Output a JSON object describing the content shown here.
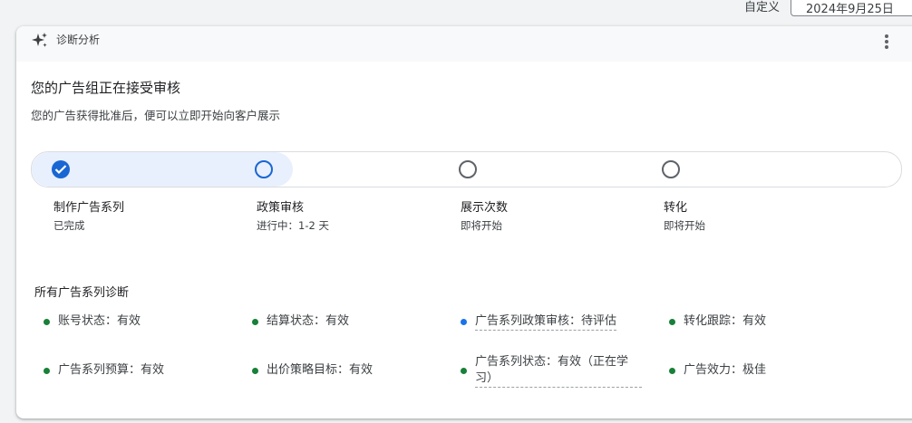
{
  "topbar": {
    "custom_label": "自定义",
    "date_value": "2024年9月25日"
  },
  "card": {
    "title": "诊断分析",
    "headline": "您的广告组正在接受审核",
    "subtext": "您的广告获得批准后，便可以立即开始向客户展示"
  },
  "progress": {
    "completed_fraction": 0.3,
    "steps": [
      {
        "name": "制作广告系列",
        "status": "已完成",
        "state": "done"
      },
      {
        "name": "政策审核",
        "status": "进行中：1-2 天",
        "state": "current"
      },
      {
        "name": "展示次数",
        "status": "即将开始",
        "state": "pending"
      },
      {
        "name": "转化",
        "status": "即将开始",
        "state": "pending"
      }
    ]
  },
  "diagnostics": {
    "title": "所有广告系列诊断",
    "items": [
      {
        "label": "账号状态：有效",
        "color": "#188038"
      },
      {
        "label": "结算状态：有效",
        "color": "#188038"
      },
      {
        "label": "广告系列政策审核：待评估",
        "color": "#1a73e8"
      },
      {
        "label": "转化跟踪：有效",
        "color": "#188038"
      },
      {
        "label": "广告系列预算：有效",
        "color": "#188038"
      },
      {
        "label": "出价策略目标：有效",
        "color": "#188038"
      },
      {
        "label": "广告系列状态：有效（正在学习）",
        "color": "#188038"
      },
      {
        "label": "广告效力：极佳",
        "color": "#188038"
      }
    ]
  }
}
